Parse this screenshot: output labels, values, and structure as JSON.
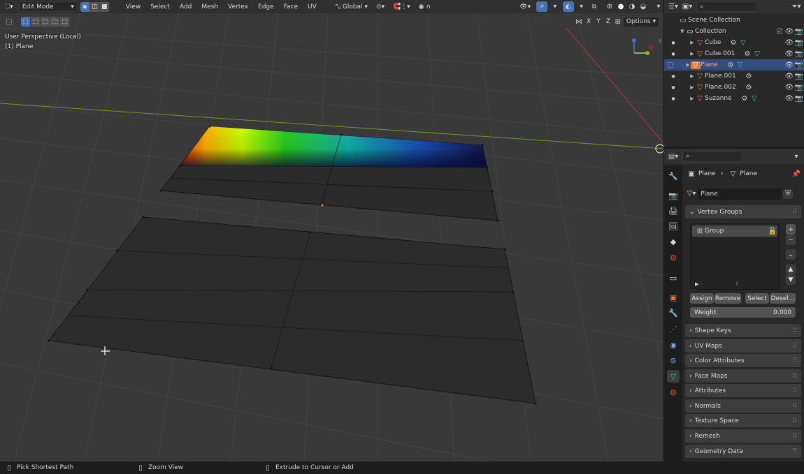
{
  "viewport": {
    "mode": "Edit Mode",
    "menus": [
      "View",
      "Select",
      "Add",
      "Mesh",
      "Vertex",
      "Edge",
      "Face",
      "UV"
    ],
    "transform_orientation": "Global",
    "overlay_line1": "User Perspective (Local)",
    "overlay_line2": "(1) Plane",
    "axis_x": "X",
    "axis_y": "Y",
    "axis_z": "Z",
    "options_label": "Options",
    "gizmo_y": "y"
  },
  "outliner": {
    "scene_collection": "Scene Collection",
    "collection": "Collection",
    "items": [
      {
        "label": "Cube"
      },
      {
        "label": "Cube.001"
      },
      {
        "label": "Plane"
      },
      {
        "label": "Plane.001"
      },
      {
        "label": "Plane.002"
      },
      {
        "label": "Suzanne"
      }
    ]
  },
  "properties": {
    "breadcrumb_object": "Plane",
    "breadcrumb_data": "Plane",
    "mesh_name": "Plane",
    "vertex_groups_title": "Vertex Groups",
    "group_name": "Group",
    "assign": "Assign",
    "remove": "Remove",
    "select": "Select",
    "deselect": "Desel...",
    "weight_label": "Weight",
    "weight_value": "0.000",
    "panels": [
      "Shape Keys",
      "UV Maps",
      "Color Attributes",
      "Face Maps",
      "Attributes",
      "Normals",
      "Texture Space",
      "Remesh",
      "Geometry Data"
    ]
  },
  "status": {
    "left": "Pick Shortest Path",
    "middle": "Zoom View",
    "right": "Extrude to Cursor or Add"
  },
  "colors": {
    "accent": "#4772b3",
    "active_row": "#334d80",
    "object_orange": "#e07d3a",
    "mesh_green": "#3fc3a5"
  }
}
